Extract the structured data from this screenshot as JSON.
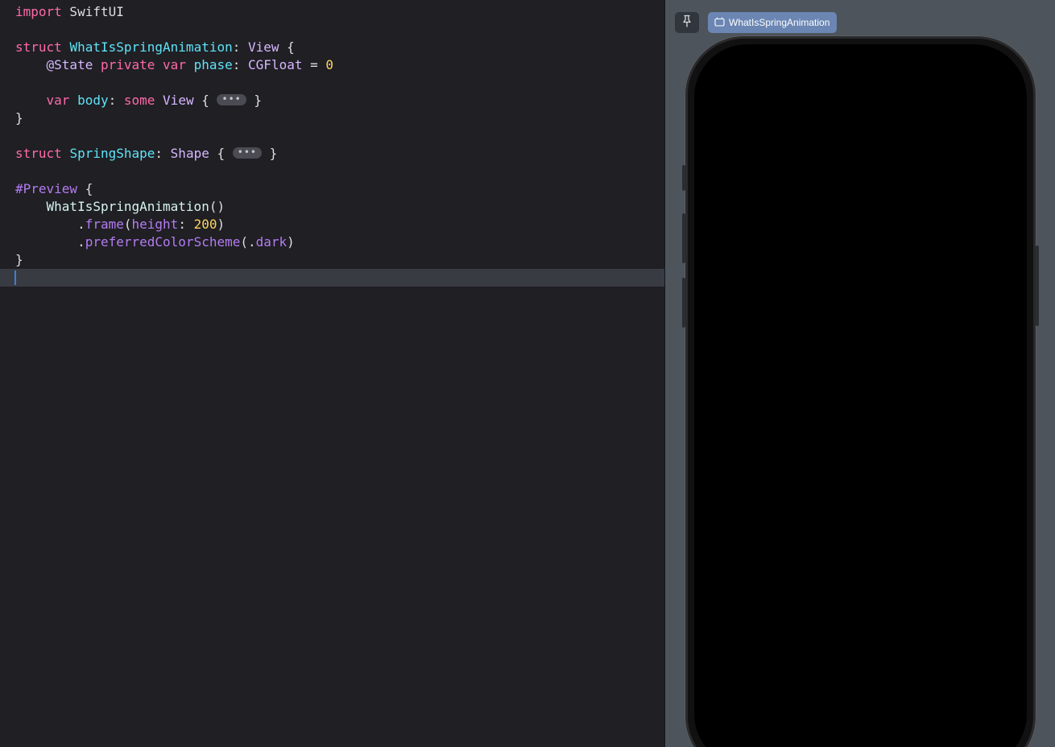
{
  "editor": {
    "lines": [
      [
        {
          "t": "import",
          "c": "kw"
        },
        {
          "t": " SwiftUI",
          "c": "plain"
        }
      ],
      [],
      [
        {
          "t": "struct",
          "c": "kw"
        },
        {
          "t": " ",
          "c": "plain"
        },
        {
          "t": "WhatIsSpringAnimation",
          "c": "decl"
        },
        {
          "t": ": ",
          "c": "plain"
        },
        {
          "t": "View",
          "c": "type"
        },
        {
          "t": " {",
          "c": "plain"
        }
      ],
      [
        {
          "t": "    ",
          "c": "plain"
        },
        {
          "t": "@State",
          "c": "attr"
        },
        {
          "t": " ",
          "c": "plain"
        },
        {
          "t": "private",
          "c": "kw"
        },
        {
          "t": " ",
          "c": "plain"
        },
        {
          "t": "var",
          "c": "kw"
        },
        {
          "t": " ",
          "c": "plain"
        },
        {
          "t": "phase",
          "c": "decl"
        },
        {
          "t": ": ",
          "c": "plain"
        },
        {
          "t": "CGFloat",
          "c": "type"
        },
        {
          "t": " = ",
          "c": "plain"
        },
        {
          "t": "0",
          "c": "num"
        }
      ],
      [],
      [
        {
          "t": "    ",
          "c": "plain"
        },
        {
          "t": "var",
          "c": "kw"
        },
        {
          "t": " ",
          "c": "plain"
        },
        {
          "t": "body",
          "c": "decl"
        },
        {
          "t": ": ",
          "c": "plain"
        },
        {
          "t": "some",
          "c": "kw"
        },
        {
          "t": " ",
          "c": "plain"
        },
        {
          "t": "View",
          "c": "type"
        },
        {
          "t": " { ",
          "c": "plain"
        },
        {
          "t": "•••",
          "c": "fold"
        },
        {
          "t": " }",
          "c": "plain"
        }
      ],
      [
        {
          "t": "}",
          "c": "plain"
        }
      ],
      [],
      [
        {
          "t": "struct",
          "c": "kw"
        },
        {
          "t": " ",
          "c": "plain"
        },
        {
          "t": "SpringShape",
          "c": "decl"
        },
        {
          "t": ": ",
          "c": "plain"
        },
        {
          "t": "Shape",
          "c": "type"
        },
        {
          "t": " { ",
          "c": "plain"
        },
        {
          "t": "•••",
          "c": "fold"
        },
        {
          "t": " }",
          "c": "plain"
        }
      ],
      [],
      [
        {
          "t": "#Preview",
          "c": "macro"
        },
        {
          "t": " {",
          "c": "plain"
        }
      ],
      [
        {
          "t": "    ",
          "c": "plain"
        },
        {
          "t": "WhatIsSpringAnimation",
          "c": "call"
        },
        {
          "t": "()",
          "c": "plain"
        }
      ],
      [
        {
          "t": "        .",
          "c": "plain"
        },
        {
          "t": "frame",
          "c": "prop"
        },
        {
          "t": "(",
          "c": "plain"
        },
        {
          "t": "height",
          "c": "prop"
        },
        {
          "t": ": ",
          "c": "plain"
        },
        {
          "t": "200",
          "c": "num"
        },
        {
          "t": ")",
          "c": "plain"
        }
      ],
      [
        {
          "t": "        .",
          "c": "plain"
        },
        {
          "t": "preferredColorScheme",
          "c": "prop"
        },
        {
          "t": "(.",
          "c": "plain"
        },
        {
          "t": "dark",
          "c": "prop"
        },
        {
          "t": ")",
          "c": "plain"
        }
      ],
      [
        {
          "t": "}",
          "c": "plain"
        }
      ],
      []
    ],
    "current_line": 15
  },
  "canvas": {
    "pin_icon": "pin-icon",
    "preview_tab": {
      "icon": "preview-window-icon",
      "label": "WhatIsSpringAnimation"
    }
  },
  "colors": {
    "keyword": "#ff6aa9",
    "declaration": "#5fe3f6",
    "type": "#d7b6ff",
    "number": "#ffd65a",
    "member": "#b47cf0",
    "editor_bg": "#1f1f24",
    "canvas_bg": "#4e545b",
    "tab_bg": "#6b86b3"
  }
}
